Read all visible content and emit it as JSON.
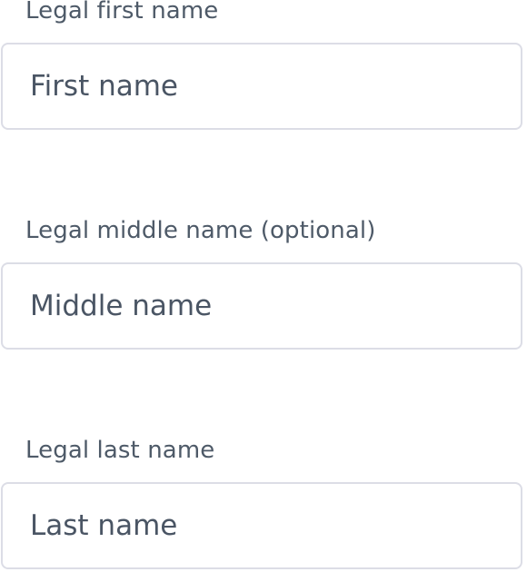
{
  "form": {
    "first_name": {
      "label": "Legal first name",
      "placeholder": "First name",
      "value": ""
    },
    "middle_name": {
      "label": "Legal middle name (optional)",
      "placeholder": "Middle name",
      "value": ""
    },
    "last_name": {
      "label": "Legal last name",
      "placeholder": "Last name",
      "value": ""
    }
  },
  "colors": {
    "label_text": "#4e5a68",
    "input_text": "#4a5564",
    "input_border": "#dcdde6",
    "background": "#ffffff"
  }
}
